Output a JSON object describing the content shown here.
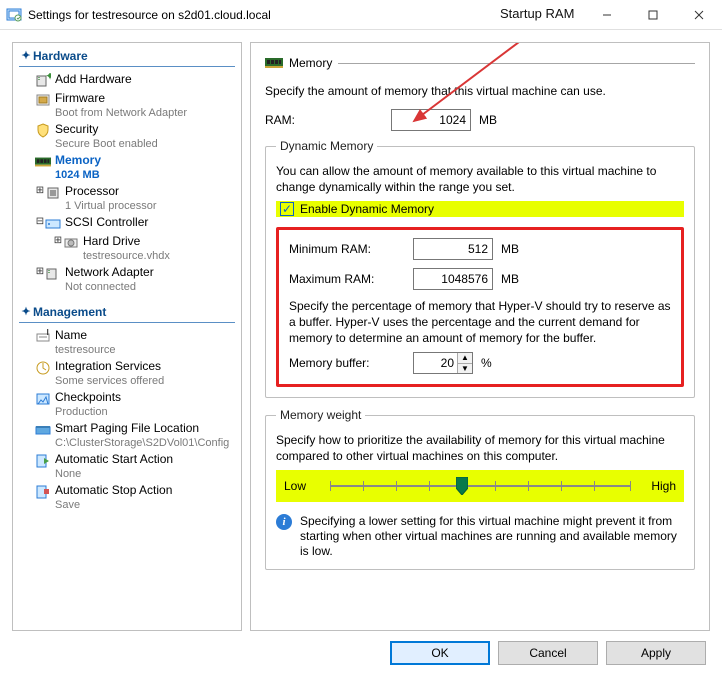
{
  "title": "Settings for testresource on s2d01.cloud.local",
  "annotation_startup_ram": "Startup RAM",
  "sections": {
    "hardware": "Hardware",
    "management": "Management"
  },
  "tree": {
    "add_hardware": "Add Hardware",
    "firmware": {
      "label": "Firmware",
      "sub": "Boot from Network Adapter"
    },
    "security": {
      "label": "Security",
      "sub": "Secure Boot enabled"
    },
    "memory": {
      "label": "Memory",
      "sub": "1024 MB"
    },
    "processor": {
      "label": "Processor",
      "sub": "1 Virtual processor"
    },
    "scsi": {
      "label": "SCSI Controller"
    },
    "hard_drive": {
      "label": "Hard Drive",
      "sub": "testresource.vhdx"
    },
    "net": {
      "label": "Network Adapter",
      "sub": "Not connected"
    },
    "name": {
      "label": "Name",
      "sub": "testresource"
    },
    "integ": {
      "label": "Integration Services",
      "sub": "Some services offered"
    },
    "check": {
      "label": "Checkpoints",
      "sub": "Production"
    },
    "spf": {
      "label": "Smart Paging File Location",
      "sub": "C:\\ClusterStorage\\S2DVol01\\Config"
    },
    "autostart": {
      "label": "Automatic Start Action",
      "sub": "None"
    },
    "autostop": {
      "label": "Automatic Stop Action",
      "sub": "Save"
    }
  },
  "panel": {
    "title": "Memory",
    "desc": "Specify the amount of memory that this virtual machine can use.",
    "ram_label": "RAM:",
    "ram_value": "1024",
    "ram_unit": "MB",
    "dynamic": {
      "legend": "Dynamic Memory",
      "desc": "You can allow the amount of memory available to this virtual machine to change dynamically within the range you set.",
      "checkbox": "Enable Dynamic Memory",
      "min_label": "Minimum RAM:",
      "min_value": "512",
      "max_label": "Maximum RAM:",
      "max_value": "1048576",
      "unit": "MB",
      "buffer_desc": "Specify the percentage of memory that Hyper-V should try to reserve as a buffer. Hyper-V uses the percentage and the current demand for memory to determine an amount of memory for the buffer.",
      "buffer_label": "Memory buffer:",
      "buffer_value": "20",
      "buffer_unit": "%"
    },
    "weight": {
      "legend": "Memory weight",
      "desc": "Specify how to prioritize the availability of memory for this virtual machine compared to other virtual machines on this computer.",
      "low": "Low",
      "high": "High",
      "info": "Specifying a lower setting for this virtual machine might prevent it from starting when other virtual machines are running and available memory is low."
    }
  },
  "buttons": {
    "ok": "OK",
    "cancel": "Cancel",
    "apply": "Apply"
  }
}
